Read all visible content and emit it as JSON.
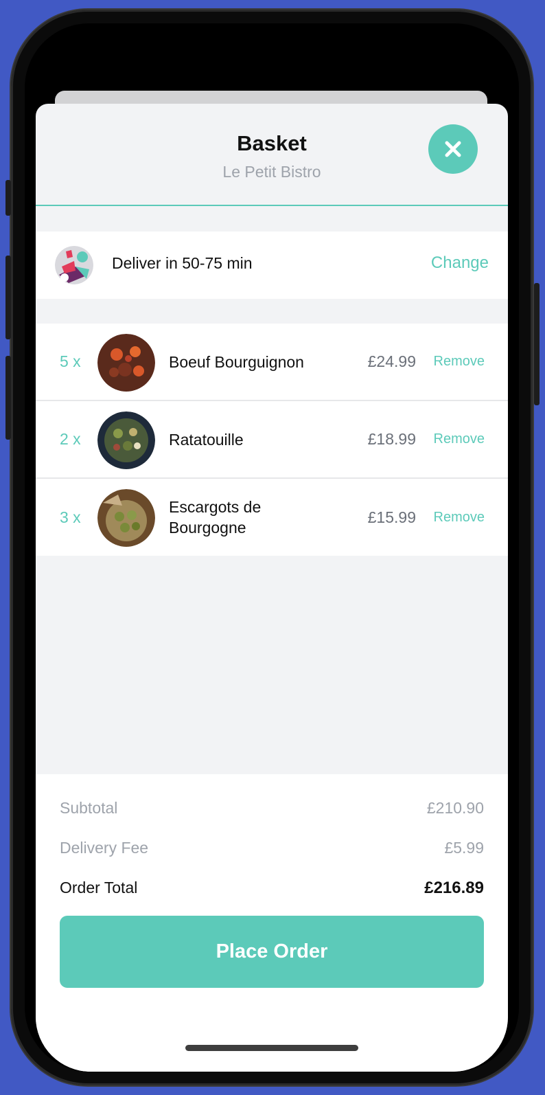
{
  "header": {
    "title": "Basket",
    "restaurant": "Le Petit Bistro",
    "close_icon": "close-icon"
  },
  "delivery": {
    "text": "Deliver in 50-75 min",
    "change_label": "Change",
    "icon": "delivery-rider-icon"
  },
  "items": [
    {
      "qty": "5 x",
      "name": "Boeuf Bourguignon",
      "price": "£24.99",
      "remove_label": "Remove"
    },
    {
      "qty": "2 x",
      "name": "Ratatouille",
      "price": "£18.99",
      "remove_label": "Remove"
    },
    {
      "qty": "3 x",
      "name": "Escargots de Bourgogne",
      "price": "£15.99",
      "remove_label": "Remove"
    }
  ],
  "summary": {
    "subtotal_label": "Subtotal",
    "subtotal_value": "£210.90",
    "delivery_fee_label": "Delivery Fee",
    "delivery_fee_value": "£5.99",
    "total_label": "Order Total",
    "total_value": "£216.89"
  },
  "cta": {
    "place_order_label": "Place Order"
  },
  "colors": {
    "accent": "#5ccab9",
    "background": "#4159c4",
    "sheet": "#f2f3f5"
  }
}
